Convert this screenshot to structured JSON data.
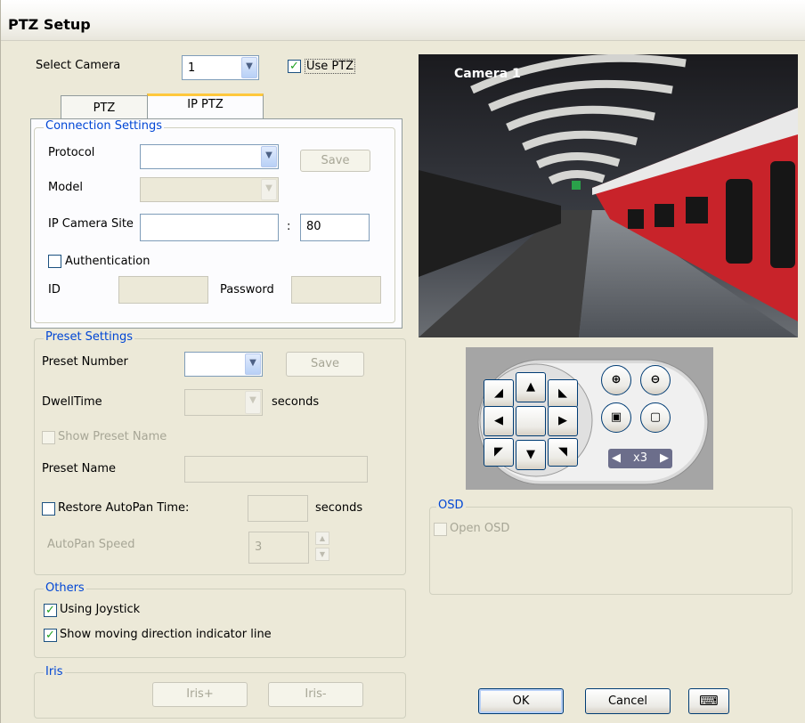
{
  "window": {
    "title": "PTZ Setup"
  },
  "camera_select": {
    "label": "Select Camera",
    "value": "1",
    "use_ptz_label": "Use PTZ",
    "use_ptz_checked": true
  },
  "tabs": [
    {
      "label": "PTZ"
    },
    {
      "label": "IP PTZ"
    }
  ],
  "connection": {
    "title": "Connection Settings",
    "protocol_label": "Protocol",
    "protocol_value": "",
    "save_label": "Save",
    "model_label": "Model",
    "model_value": "",
    "ip_site_label": "IP Camera Site",
    "ip_site_value": "",
    "colon": ":",
    "port_value": "80",
    "auth_label": "Authentication",
    "auth_checked": false,
    "id_label": "ID",
    "id_value": "",
    "password_label": "Password",
    "password_value": ""
  },
  "preset": {
    "title": "Preset Settings",
    "number_label": "Preset Number",
    "number_value": "",
    "save_label": "Save",
    "dwell_label": "DwellTime",
    "dwell_value": "",
    "dwell_unit": "seconds",
    "show_name_label": "Show Preset Name",
    "show_name_checked": false,
    "name_label": "Preset Name",
    "name_value": "",
    "restore_label": "Restore AutoPan Time:",
    "restore_checked": false,
    "restore_value": "",
    "restore_unit": "seconds",
    "speed_label": "AutoPan Speed",
    "speed_value": "3"
  },
  "others": {
    "title": "Others",
    "joystick_label": "Using Joystick",
    "joystick_checked": true,
    "indicator_label": "Show moving direction indicator line",
    "indicator_checked": true
  },
  "iris": {
    "title": "Iris",
    "plus_label": "Iris+",
    "minus_label": "Iris-"
  },
  "camera_view": {
    "overlay_label": "Camera 1"
  },
  "ptz_pad": {
    "zoom_label": "x3"
  },
  "osd": {
    "title": "OSD",
    "open_label": "Open OSD",
    "open_checked": false
  },
  "footer": {
    "ok_label": "OK",
    "cancel_label": "Cancel"
  },
  "colors": {
    "accent": "#0046d5",
    "check": "#21a121",
    "train_red": "#c8232a"
  }
}
